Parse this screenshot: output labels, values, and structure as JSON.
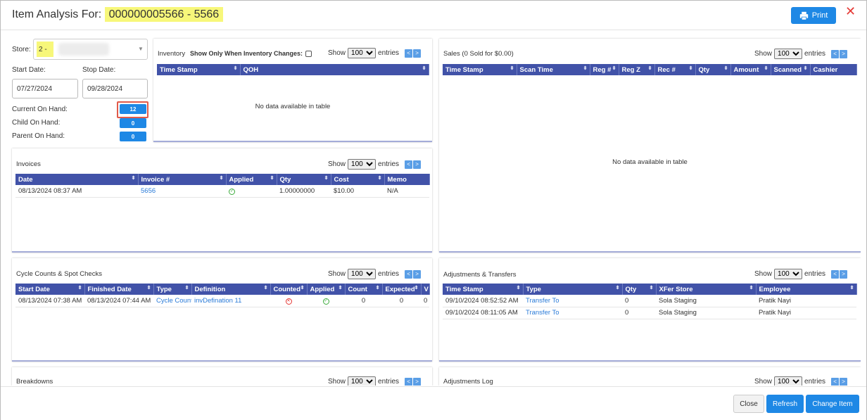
{
  "header": {
    "title_prefix": "Item Analysis For: ",
    "title_item": "000000005566 - 5566",
    "print_label": "Print",
    "close_glyph": "✕"
  },
  "filters": {
    "store_label": "Store:",
    "store_value": "2 - ",
    "start_label": "Start Date:",
    "start_value": "07/27/2024",
    "stop_label": "Stop Date:",
    "stop_value": "09/28/2024",
    "current_label": "Current On Hand:",
    "current_value": "12",
    "child_label": "Child On Hand:",
    "child_value": "0",
    "parent_label": "Parent On Hand:",
    "parent_value": "0"
  },
  "common": {
    "show": "Show",
    "entries": "entries",
    "page_size": "100",
    "prev": "<",
    "next": ">",
    "sort_glyph": "⬍",
    "no_data": "No data available in table"
  },
  "inventory": {
    "title": "Inventory",
    "toggle_label": "Show Only When Inventory Changes:",
    "columns": [
      "Time Stamp",
      "QOH"
    ]
  },
  "sales": {
    "title": "Sales (0 Sold for $0.00)",
    "columns": [
      "Time Stamp",
      "Scan Time",
      "Reg #",
      "Reg Z",
      "Rec #",
      "Qty",
      "Amount",
      "Scanned",
      "Cashier"
    ]
  },
  "invoices": {
    "title": "Invoices",
    "columns": [
      "Date",
      "Invoice #",
      "Applied",
      "Qty",
      "Cost",
      "Memo"
    ],
    "rows": [
      {
        "date": "08/13/2024 08:37 AM",
        "invoice": "5656",
        "qty": "1.00000000",
        "cost": "$10.00",
        "memo": "N/A"
      }
    ]
  },
  "cycle_counts": {
    "title": "Cycle Counts & Spot Checks",
    "columns": [
      "Start Date",
      "Finished Date",
      "Type",
      "Definition",
      "Counted",
      "Applied",
      "Count",
      "Expected",
      "V"
    ],
    "rows": [
      {
        "start": "08/13/2024 07:38 AM",
        "finished": "08/13/2024 07:44 AM",
        "type": "Cycle Count",
        "definition": "invDefination 11",
        "count": "0",
        "expected": "0",
        "v": "0"
      }
    ]
  },
  "adjustments": {
    "title": "Adjustments & Transfers",
    "columns": [
      "Time Stamp",
      "Type",
      "Qty",
      "XFer Store",
      "Employee"
    ],
    "rows": [
      {
        "time": "09/10/2024 08:52:52 AM",
        "type": "Transfer To",
        "qty": "0",
        "store": "Sola Staging",
        "employee": "Pratik Nayi"
      },
      {
        "time": "09/10/2024 08:11:05 AM",
        "type": "Transfer To",
        "qty": "0",
        "store": "Sola Staging",
        "employee": "Pratik Nayi"
      }
    ]
  },
  "breakdowns": {
    "title": "Breakdowns"
  },
  "adjustments_log": {
    "title": "Adjustments Log"
  },
  "footer": {
    "close_label": "Close",
    "refresh_label": "Refresh",
    "change_label": "Change Item"
  },
  "colors": {
    "accent": "#1e88e5",
    "table_header": "#4152a8",
    "highlight": "#f7f77a",
    "close_red": "#e53935"
  },
  "icons": [
    "print-icon",
    "close-icon",
    "chevron-down-icon",
    "sort-icon",
    "check-circle-icon",
    "x-circle-icon",
    "prev-page-icon",
    "next-page-icon"
  ]
}
